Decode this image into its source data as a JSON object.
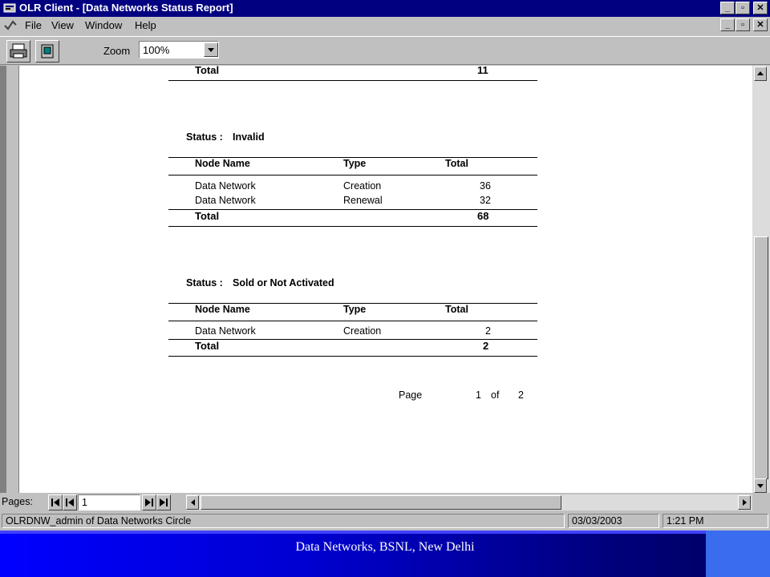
{
  "window": {
    "title": "OLR Client - [Data Networks Status Report]",
    "minimize": "_",
    "restore": "▫",
    "close": "✕"
  },
  "menu": {
    "items": [
      "File",
      "View",
      "Window",
      "Help"
    ]
  },
  "toolbar": {
    "zoom_label": "Zoom",
    "zoom_value": "100%"
  },
  "report": {
    "prev_total_label": "Total",
    "prev_total_value": "11",
    "sections": [
      {
        "status_label": "Status :",
        "status_value": "Invalid",
        "headers": [
          "Node Name",
          "Type",
          "Total"
        ],
        "rows": [
          [
            "Data Network",
            "Creation",
            "36"
          ],
          [
            "Data Network",
            "Renewal",
            "32"
          ]
        ],
        "total_label": "Total",
        "total_value": "68"
      },
      {
        "status_label": "Status :",
        "status_value": "Sold or Not Activated",
        "headers": [
          "Node Name",
          "Type",
          "Total"
        ],
        "rows": [
          [
            "Data Network",
            "Creation",
            "2"
          ]
        ],
        "total_label": "Total",
        "total_value": "2"
      }
    ],
    "page_label": "Page",
    "page_current": "1",
    "page_of": "of",
    "page_total": "2"
  },
  "navigator": {
    "pages_label": "Pages:",
    "page_input": "1"
  },
  "status": {
    "user": "OLRDNW_admin of Data Networks Circle",
    "date": "03/03/2003",
    "time": "1:21 PM"
  },
  "footer": {
    "text": "Data Networks, BSNL, New Delhi"
  }
}
